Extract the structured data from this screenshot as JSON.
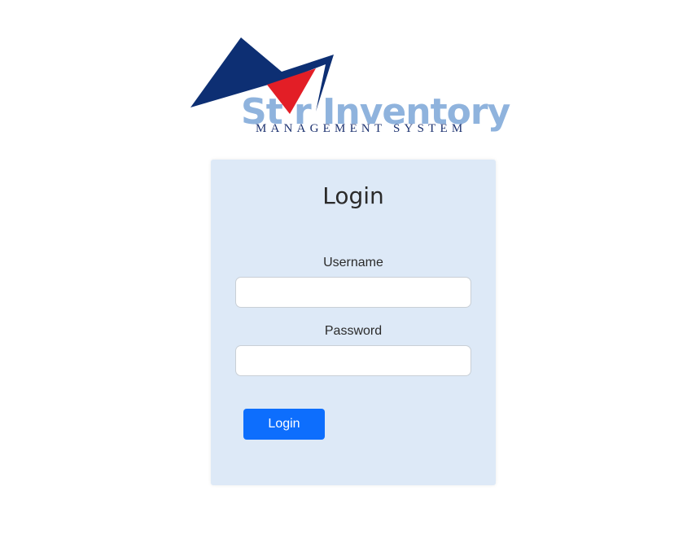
{
  "logo": {
    "wordmark": "St r Inventory",
    "tagline": "MANAGEMENT SYSTEM",
    "colors": {
      "navy": "#0d2f73",
      "red": "#e31e26",
      "light_blue": "#8fb3dd"
    }
  },
  "login_form": {
    "title": "Login",
    "username_label": "Username",
    "username_value": "",
    "password_label": "Password",
    "password_value": "",
    "submit_label": "Login",
    "accent_color": "#0d6efd",
    "card_color": "#dde9f7"
  }
}
